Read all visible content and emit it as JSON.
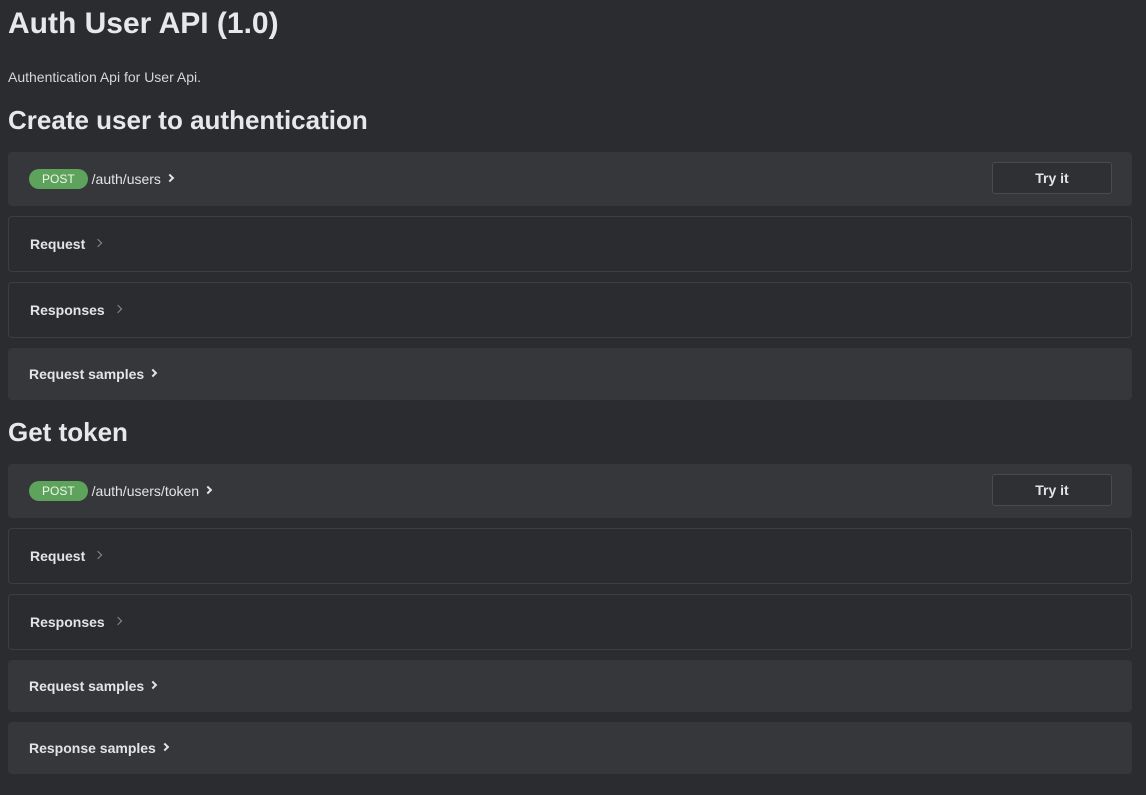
{
  "api": {
    "title": "Auth User API (1.0)",
    "description": "Authentication Api for User Api."
  },
  "operations": [
    {
      "title": "Create user to authentication",
      "method": "POST",
      "path": "/auth/users",
      "try_label": "Try it",
      "request_label": "Request",
      "responses_label": "Responses",
      "request_samples_label": "Request samples"
    },
    {
      "title": "Get token",
      "method": "POST",
      "path": "/auth/users/token",
      "try_label": "Try it",
      "request_label": "Request",
      "responses_label": "Responses",
      "request_samples_label": "Request samples",
      "response_samples_label": "Response samples"
    }
  ],
  "colors": {
    "background": "#2b2c30",
    "panel": "#36373b",
    "post_badge": "#5ea35c"
  }
}
